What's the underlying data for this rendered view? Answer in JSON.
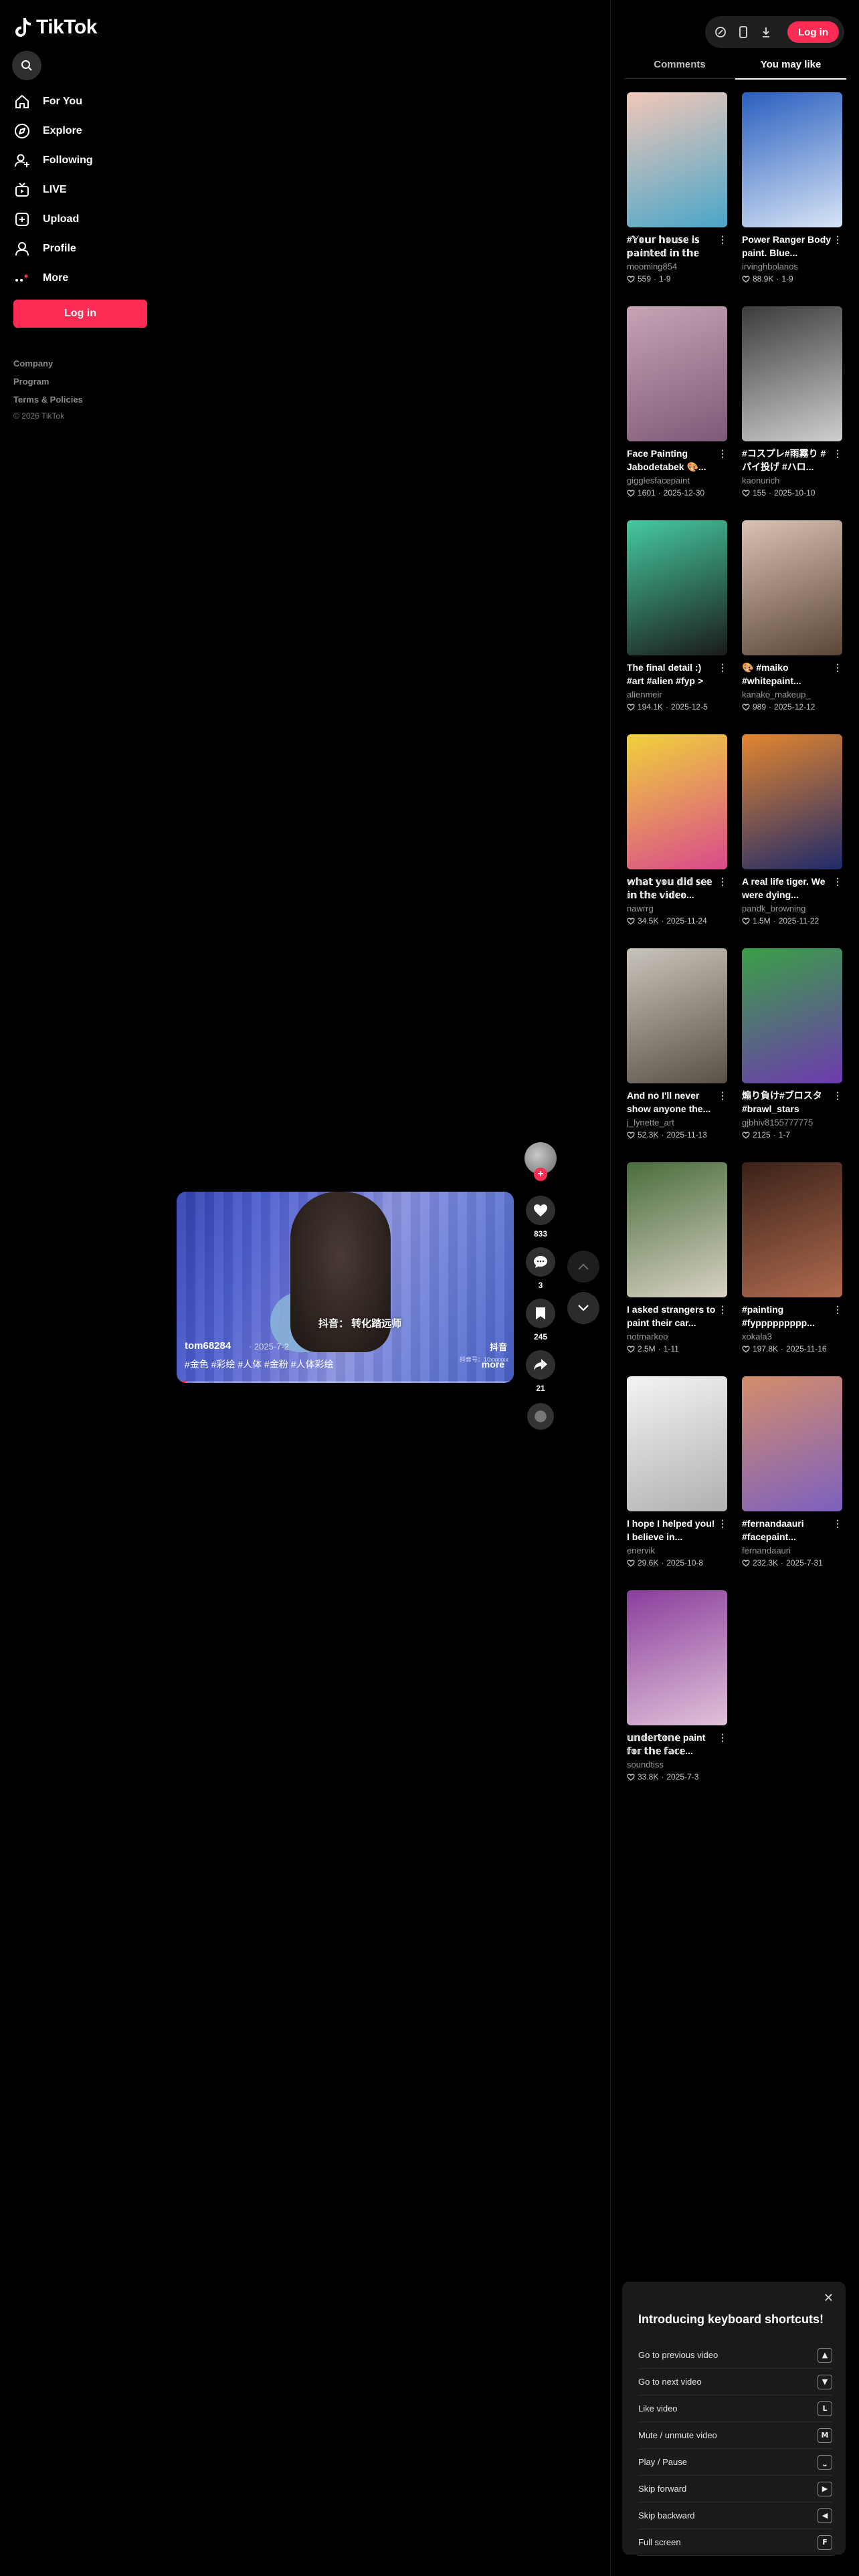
{
  "app": {
    "name": "TikTok"
  },
  "sidebar": {
    "items": [
      {
        "label": "For You",
        "icon": "home-icon"
      },
      {
        "label": "Explore",
        "icon": "compass-icon"
      },
      {
        "label": "Following",
        "icon": "user-plus-icon"
      },
      {
        "label": "LIVE",
        "icon": "live-icon"
      },
      {
        "label": "Upload",
        "icon": "upload-icon"
      },
      {
        "label": "Profile",
        "icon": "profile-icon"
      },
      {
        "label": "More",
        "icon": "more-icon"
      }
    ],
    "login_label": "Log in",
    "footer": {
      "company": "Company",
      "program": "Program",
      "terms": "Terms & Policies",
      "copyright": "© 2026 TikTok"
    }
  },
  "video": {
    "author": "tom68284",
    "date": "· 2025-7-2",
    "tags": "#金色 #彩绘 #人体 #金粉 #人体彩绘",
    "more_label": "more",
    "overlay_caption": "抖音：  转化踏远师",
    "watermark": "抖音",
    "watermark_id": "抖音号：10xxxxxx",
    "progress_percent": 3,
    "stats": {
      "likes": "833",
      "comments": "3",
      "saves": "245",
      "shares": "21"
    }
  },
  "topbar": {
    "login_label": "Log in"
  },
  "panel": {
    "tabs": [
      {
        "label": "Comments",
        "active": false
      },
      {
        "label": "You may like",
        "active": true
      }
    ],
    "cards": [
      {
        "title": "#𝕐𝕠𝕦𝕣 𝕙𝕠𝕦𝕤𝕖 𝕚𝕤 𝕡𝕒𝕚𝕟𝕥𝕖𝕕 𝕚𝕟 𝕥𝕙𝕖 𝕔𝕠𝕝𝕠𝕣...",
        "author": "mooming854",
        "likes": "559",
        "date": "1-9",
        "c1": "#f2c7b8",
        "c2": "#4aa6c9"
      },
      {
        "title": "Power Ranger Body paint. Blue...",
        "author": "irvinghbolanos",
        "likes": "88.9K",
        "date": "1-9",
        "c1": "#2a5fbf",
        "c2": "#d7e4f5"
      },
      {
        "title": "Face Painting Jabodetabek 🎨...",
        "author": "gigglesfacepaint",
        "likes": "1601",
        "date": "2025-12-30",
        "c1": "#c7a3b5",
        "c2": "#7f5a78"
      },
      {
        "title": "#コスプレ#雨霧り #パイ投げ #ハロ...",
        "author": "kaonurich",
        "likes": "155",
        "date": "2025-10-10",
        "c1": "#3b3b3b",
        "c2": "#cfcfcf"
      },
      {
        "title": "The final detail :) #art #alien #fyp >",
        "author": "alienmeir",
        "likes": "194.1K",
        "date": "2025-12-5",
        "c1": "#45c9a0",
        "c2": "#1b1b1b"
      },
      {
        "title": "🎨 #maiko #whitepaint...",
        "author": "kanako_makeup_",
        "likes": "989",
        "date": "2025-12-12",
        "c1": "#d9c2b3",
        "c2": "#5c4638"
      },
      {
        "title": "𝕨𝕙𝕒𝕥 𝕪𝕠𝕦 𝕕𝕚𝕕 𝕤𝕖𝕖 𝕚𝕟 𝕥𝕙𝕖 𝕧𝕚𝕕𝕖𝕠...",
        "author": "nawrrg",
        "likes": "34.5K",
        "date": "2025-11-24",
        "c1": "#f0d23a",
        "c2": "#d94a8c"
      },
      {
        "title": "A real life tiger. We were dying...",
        "author": "pandk_browning",
        "likes": "1.5M",
        "date": "2025-11-22",
        "c1": "#e3862f",
        "c2": "#1f2a6b"
      },
      {
        "title": "And no I'll never show anyone the...",
        "author": "j_lynette_art",
        "likes": "52.3K",
        "date": "2025-11-13",
        "c1": "#c9c4bb",
        "c2": "#5a5148"
      },
      {
        "title": "煽り負け#ブロスタ #brawl_stars",
        "author": "gjbhiv8155777775",
        "likes": "2125",
        "date": "1-7",
        "c1": "#3aa046",
        "c2": "#6e3ab0"
      },
      {
        "title": "I asked strangers to paint their car...",
        "author": "notmarkoo",
        "likes": "2.5M",
        "date": "1-11",
        "c1": "#4a6d3c",
        "c2": "#d9d2c4"
      },
      {
        "title": "#painting #fyppppppppp...",
        "author": "xokala3",
        "likes": "197.8K",
        "date": "2025-11-16",
        "c1": "#3a2118",
        "c2": "#b06b4f"
      },
      {
        "title": "I hope I helped you! I believe in...",
        "author": "enervik",
        "likes": "29.6K",
        "date": "2025-10-8",
        "c1": "#f4f4f4",
        "c2": "#b0b0b0"
      },
      {
        "title": "#fernandaauri #facepaint...",
        "author": "fernandaauri",
        "likes": "232.3K",
        "date": "2025-7-31",
        "c1": "#d48d6a",
        "c2": "#7c60c0"
      },
      {
        "title": "𝕦𝕟𝕕𝕖𝕣𝕥𝕠𝕟𝕖 paint 𝕗𝕠𝕣 𝕥𝕙𝕖 𝕗𝕒𝕔𝕖...",
        "author": "soundtiss",
        "likes": "33.8K",
        "date": "2025-7-3",
        "c1": "#8a3e9c",
        "c2": "#e1c2d9"
      }
    ]
  },
  "shortcuts": {
    "title": "Introducing keyboard shortcuts!",
    "items": [
      {
        "label": "Go to previous video",
        "key": "▲"
      },
      {
        "label": "Go to next video",
        "key": "▼"
      },
      {
        "label": "Like video",
        "key": "L"
      },
      {
        "label": "Mute / unmute video",
        "key": "M"
      },
      {
        "label": "Play / Pause",
        "key": "⎵"
      },
      {
        "label": "Skip forward",
        "key": "▶"
      },
      {
        "label": "Skip backward",
        "key": "◀"
      },
      {
        "label": "Full screen",
        "key": "F"
      }
    ]
  },
  "colors": {
    "accent": "#fe2c55",
    "background": "#000000",
    "surface": "#1f1f1f"
  }
}
